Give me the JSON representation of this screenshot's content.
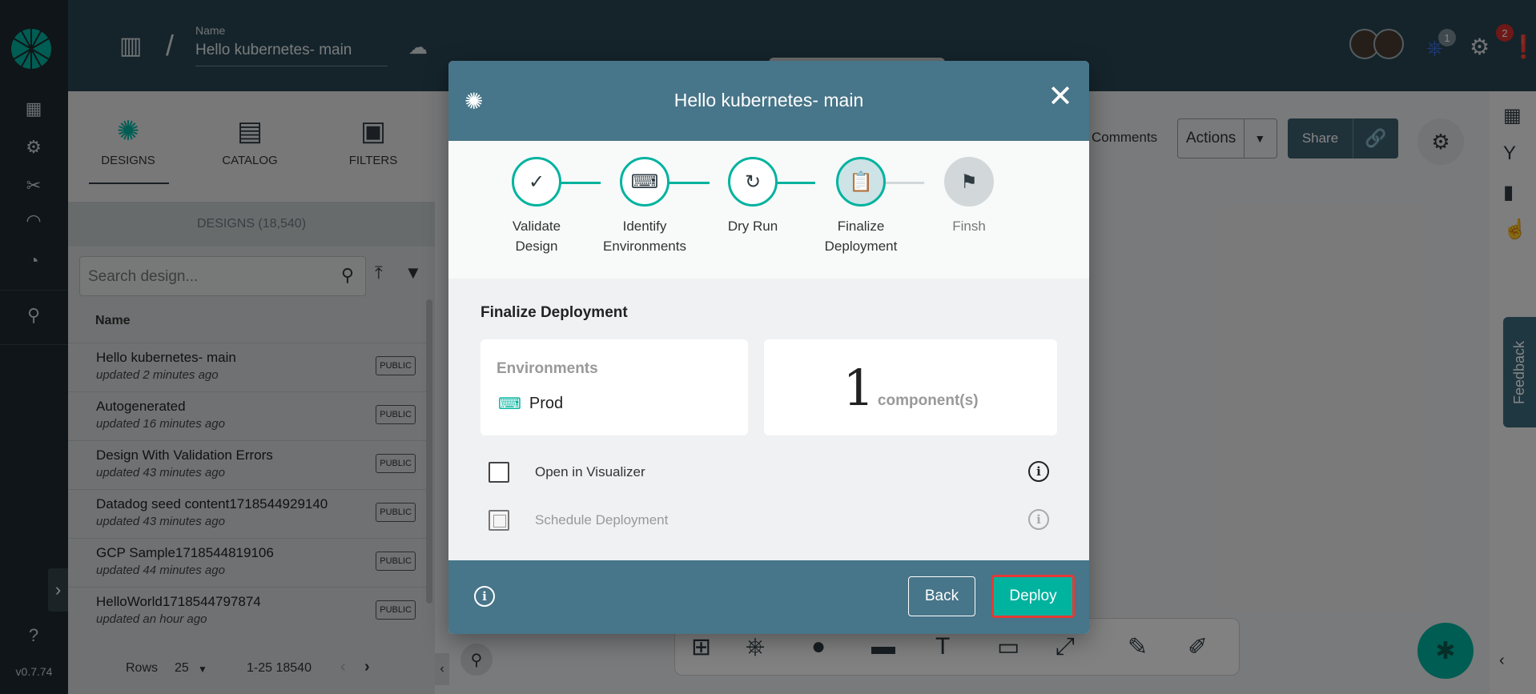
{
  "app": {
    "version": "v0.7.74",
    "header": {
      "name_label": "Name",
      "design_name": "Hello kubernetes- main",
      "badge_k8s": "1",
      "badge_alerts": "2"
    },
    "panel": {
      "tabs": [
        {
          "label": "DESIGNS",
          "icon": "designs-icon"
        },
        {
          "label": "CATALOG",
          "icon": "catalog-icon"
        },
        {
          "label": "FILTERS",
          "icon": "filters-icon"
        }
      ],
      "designs_count": "DESIGNS (18,540)",
      "search_placeholder": "Search design...",
      "column_name": "Name",
      "rows": [
        {
          "title": "Hello kubernetes- main",
          "subtitle": "updated 2 minutes ago",
          "badge": "PUBLIC"
        },
        {
          "title": "Autogenerated",
          "subtitle": "updated 16 minutes ago",
          "badge": "PUBLIC"
        },
        {
          "title": "Design With Validation Errors",
          "subtitle": "updated 43 minutes ago",
          "badge": "PUBLIC"
        },
        {
          "title": "Datadog seed content1718544929140",
          "subtitle": "updated 43 minutes ago",
          "badge": "PUBLIC"
        },
        {
          "title": "GCP Sample1718544819106",
          "subtitle": "updated 44 minutes ago",
          "badge": "PUBLIC"
        },
        {
          "title": "HelloWorld1718544797874",
          "subtitle": "updated an hour ago",
          "badge": "PUBLIC"
        }
      ],
      "pagination": {
        "rows_label": "Rows",
        "rows_value": "25",
        "range": "1-25 18540"
      }
    },
    "canvas": {
      "comments": "Comments",
      "actions": "Actions",
      "share": "Share",
      "feedback": "Feedback"
    },
    "colors": {
      "accent": "#00b39f",
      "header": "#2a4654",
      "modal": "#477589",
      "highlight": "#e53935"
    }
  },
  "modal": {
    "title": "Hello kubernetes- main",
    "steps": [
      {
        "label": "Validate Design",
        "state": "done",
        "icon": "check-icon"
      },
      {
        "label": "Identify Environments",
        "state": "done",
        "icon": "environment-icon"
      },
      {
        "label": "Dry Run",
        "state": "done",
        "icon": "dry-run-icon"
      },
      {
        "label": "Finalize Deployment",
        "state": "current",
        "icon": "clipboard-gear-icon"
      },
      {
        "label": "Finsh",
        "state": "pending",
        "icon": "checkered-flags-icon"
      }
    ],
    "section_title": "Finalize Deployment",
    "environments_heading": "Environments",
    "environment": "Prod",
    "component_count": "1",
    "component_unit": "component(s)",
    "options": [
      {
        "label": "Open in Visualizer",
        "checked": false,
        "disabled": false
      },
      {
        "label": "Schedule Deployment",
        "checked": false,
        "disabled": true
      }
    ],
    "back_label": "Back",
    "deploy_label": "Deploy"
  }
}
